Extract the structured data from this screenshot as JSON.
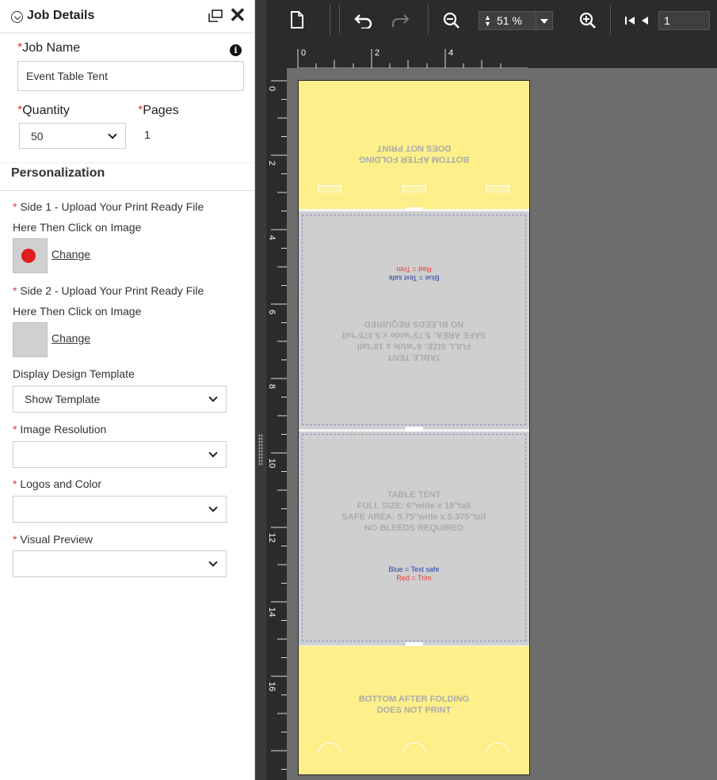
{
  "panel": {
    "title": "Job Details",
    "required_mark": "*",
    "job_name": {
      "label": "Job Name",
      "value": "Event Table Tent"
    },
    "quantity": {
      "label": "Quantity",
      "value": "50"
    },
    "pages": {
      "label": "Pages",
      "value": "1"
    },
    "personalization": {
      "title": "Personalization",
      "side1": {
        "label_line1": "Side 1 - Upload Your Print Ready File",
        "label_line2": "Here Then Click on Image",
        "change": "Change"
      },
      "side2": {
        "label_line1": "Side 2 - Upload Your Print Ready File",
        "label_line2": "Here Then Click on Image",
        "change": "Change"
      },
      "display_template": {
        "label": "Display Design Template",
        "value": "Show Template"
      },
      "image_resolution": {
        "label": "Image Resolution",
        "value": ""
      },
      "logos_color": {
        "label": "Logos and Color",
        "value": ""
      },
      "visual_preview": {
        "label": "Visual Preview",
        "value": ""
      }
    }
  },
  "toolbar": {
    "icons": [
      "new-page-icon",
      "undo-icon",
      "redo-icon",
      "zoom-out-icon",
      "zoom-in-icon",
      "first-page-icon",
      "prev-page-icon"
    ],
    "zoom": "51 %",
    "page": "1"
  },
  "ruler": {
    "h_labels": [
      "0",
      "2",
      "4"
    ],
    "v_labels": [
      "0",
      "2",
      "4",
      "6",
      "8",
      "10",
      "12",
      "14",
      "16"
    ]
  },
  "template": {
    "bottom_lines": [
      "BOTTOM AFTER FOLDING",
      "DOES NOT PRINT"
    ],
    "tent_lines": [
      "TABLE TENT",
      "FULL SIZE: 6\"wide x 18\"tall",
      "SAFE AREA: 5.75\"wide x 5.375\"tall",
      "NO BLEEDS REQUIRED"
    ],
    "blue_note": "Blue = Text safe",
    "red_note": "Red = Trim",
    "colors": {
      "yellow": "#fdef8a",
      "grey": "#cfcfcf",
      "blue": "#2b3fa8",
      "red": "#e53935"
    }
  }
}
